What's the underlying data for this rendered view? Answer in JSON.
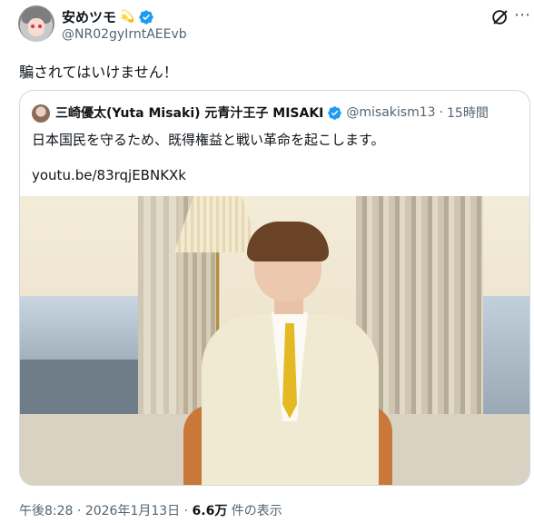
{
  "author": {
    "display_name": "安めツモ",
    "name_emoji": "💫",
    "handle": "@NR02gyIrntAEEvb",
    "verified": true
  },
  "tweet": {
    "text": "騙されてはいけません！"
  },
  "quoted": {
    "display_name": "三崎優太(Yuta Misaki) 元青汁王子 MISAKI",
    "verified": true,
    "handle": "@misakism13",
    "separator": "·",
    "time": "15時間",
    "text": "日本国民を守るため、既得権益と戦い革命を起こします。",
    "link": "youtu.be/83rqjEBNKXk"
  },
  "meta": {
    "time": "午後8:28",
    "sep1": "·",
    "date": "2026年1月13日",
    "sep2": "·",
    "views_count": "6.6万",
    "views_label": "件の表示"
  },
  "icons": {
    "grok": "grok-icon",
    "more": "more-icon",
    "verified": "verified-badge-icon"
  },
  "colors": {
    "verified_blue": "#1d9bf0",
    "secondary_text": "#536471",
    "border": "#cfd9de"
  }
}
